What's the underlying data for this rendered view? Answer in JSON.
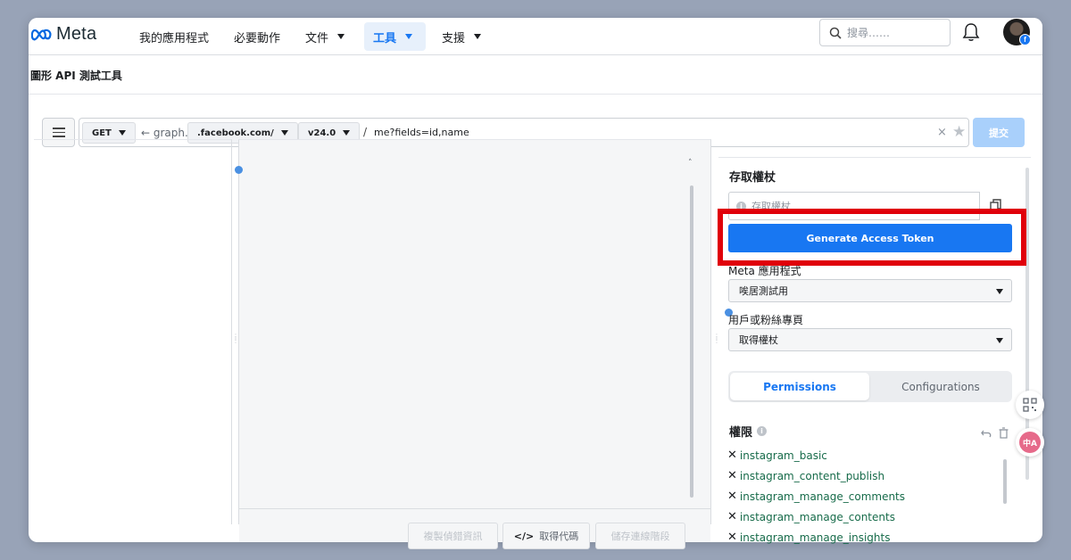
{
  "nav": {
    "logo_text": "Meta",
    "items": [
      {
        "label": "我的應用程式"
      },
      {
        "label": "必要動作"
      },
      {
        "label": "文件"
      },
      {
        "label": "工具"
      },
      {
        "label": "支援"
      }
    ],
    "search_placeholder": "搜尋……"
  },
  "page": {
    "title": "圖形 API 測試工具"
  },
  "query": {
    "method": "GET",
    "graph_prefix": "← graph.",
    "domain": ".facebook.com/",
    "version": "v24.0",
    "slash": "/",
    "path": "me?fields=id,name",
    "clear": "×",
    "star": "★",
    "submit_label": "提交"
  },
  "center": {
    "footer_buttons": [
      {
        "label": "複製偵錯資訊"
      },
      {
        "label": "取得代碼"
      },
      {
        "label": "儲存連線階段"
      }
    ],
    "code_icon": "</>"
  },
  "right": {
    "token_title": "存取權杖",
    "token_placeholder": "存取權杖",
    "generate_label": "Generate Access Token",
    "app_label": "Meta 應用程式",
    "app_value": "唉居測試用",
    "user_label": "用戶或粉絲專頁",
    "user_value": "取得權杖",
    "tabs": [
      {
        "label": "Permissions"
      },
      {
        "label": "Configurations"
      }
    ],
    "permissions_title": "權限",
    "permissions": [
      {
        "name": "instagram_basic"
      },
      {
        "name": "instagram_content_publish"
      },
      {
        "name": "instagram_manage_comments"
      },
      {
        "name": "instagram_manage_contents"
      },
      {
        "name": "instagram_manage_insights"
      }
    ]
  },
  "colors": {
    "accent": "#1877f2",
    "highlight": "#e0000a",
    "permission_text": "#176b4a"
  }
}
